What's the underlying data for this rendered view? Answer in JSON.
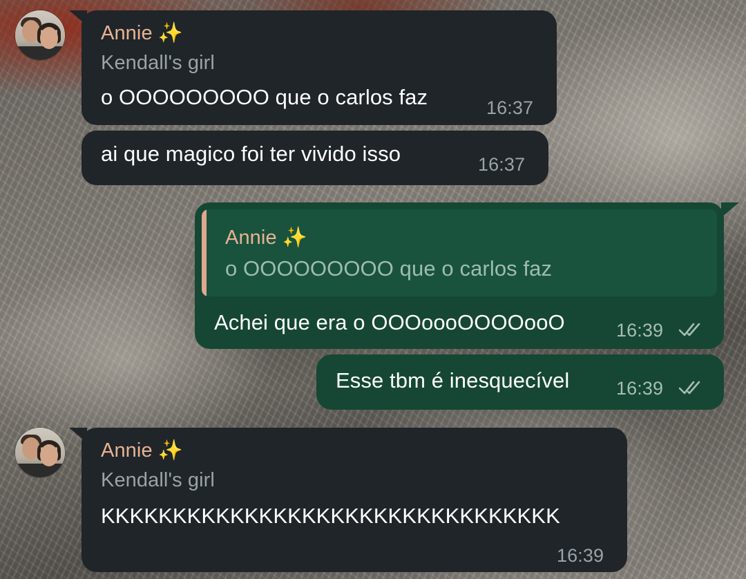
{
  "messages": [
    {
      "sender": "Annie ✨",
      "subtitle": "Kendall's girl",
      "text": "o OOOOOOOOO que o carlos faz",
      "time": "16:37"
    },
    {
      "text": "ai que magico foi ter vivido isso",
      "time": "16:37"
    },
    {
      "reply_to": {
        "sender": "Annie ✨",
        "text": "o OOOOOOOOO que o carlos faz"
      },
      "text": "Achei que era o OOOoooOOOOooO",
      "time": "16:39",
      "status": "read"
    },
    {
      "text": "Esse tbm é inesquecível",
      "time": "16:39",
      "status": "read"
    },
    {
      "sender": "Annie ✨",
      "subtitle": "Kendall's girl",
      "text": "KKKKKKKKKKKKKKKKKKKKKKKKKKKKKKKK",
      "time": "16:39"
    }
  ],
  "colors": {
    "incoming_bubble": "#1f2529",
    "outgoing_bubble": "#154734",
    "sender_name": "#e8b394",
    "quote_bar": "#e1a78f"
  },
  "icons": [
    "avatar-photo",
    "double-check-icon"
  ]
}
